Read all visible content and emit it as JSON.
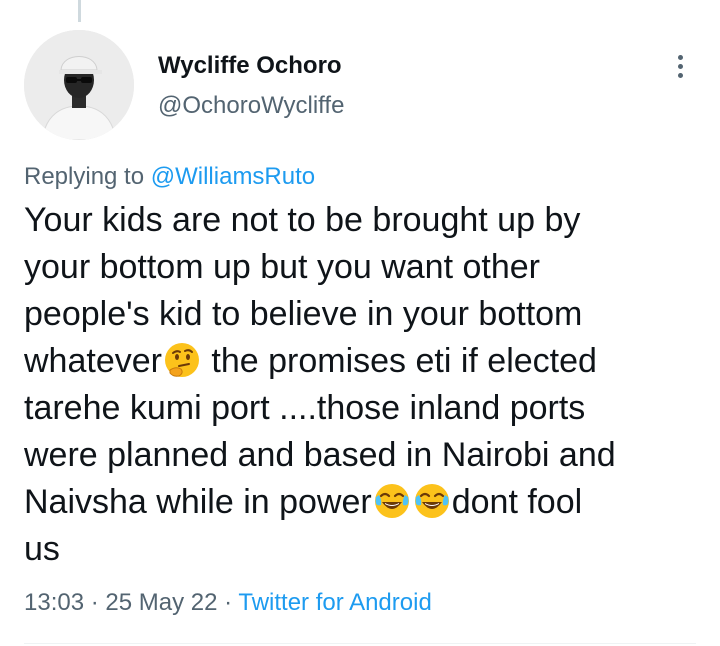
{
  "author": {
    "display_name": "Wycliffe Ochoro",
    "handle": "@OchoroWycliffe"
  },
  "reply": {
    "prefix": "Replying to ",
    "mention": "@WilliamsRuto"
  },
  "tweet": {
    "lines": [
      "Your kids are not to be brought up by",
      "your bottom up but you want other",
      "people's kid to believe in your bottom",
      "whatever",
      " the promises eti if elected",
      "tarehe kumi port ....those inland ports",
      "were planned and based in Nairobi and",
      "Naivsha  while in power",
      "dont fool",
      "us"
    ],
    "emoji_names": [
      "thinking-face",
      "face-with-tears-of-joy",
      "face-with-tears-of-joy"
    ]
  },
  "meta": {
    "time": "13:03",
    "sep1": " · ",
    "date": "25 May 22",
    "sep2": " · ",
    "source": "Twitter for Android"
  },
  "icons": {
    "more": "more-vertical-icon"
  },
  "colors": {
    "text": "#0f1419",
    "muted": "#536471",
    "accent": "#1d9bf0"
  }
}
